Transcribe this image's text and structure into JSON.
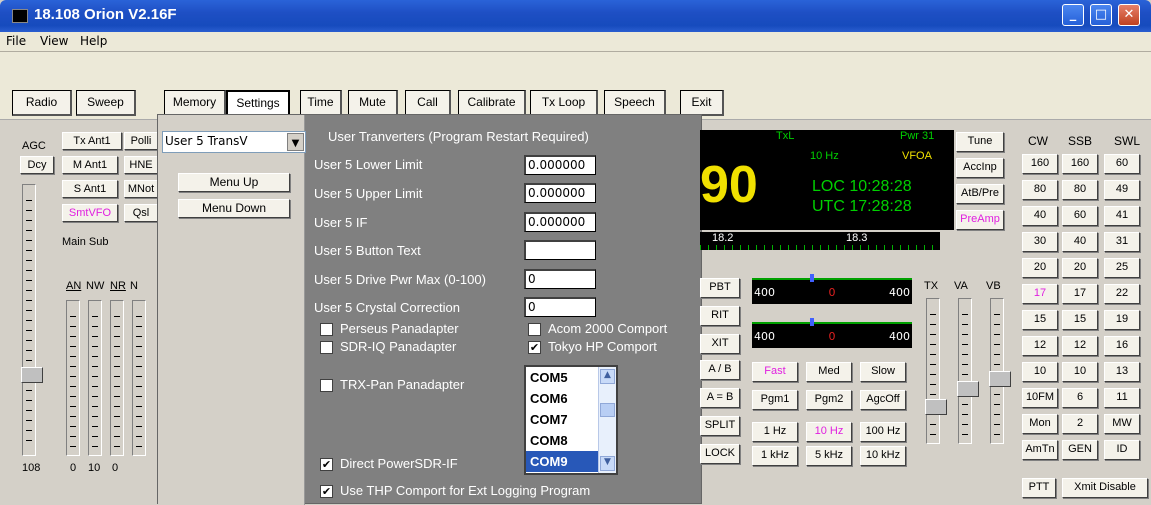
{
  "window": {
    "title": "18.108 Orion V2.16F",
    "minimize": "_",
    "maximize": "□",
    "close": "✕"
  },
  "menu": [
    "File",
    "View",
    "Help"
  ],
  "toolbar": [
    "Radio",
    "Sweep",
    "Memory",
    "Settings",
    "Time",
    "Mute",
    "Call",
    "Calibrate",
    "Tx Loop",
    "Speech",
    "Exit"
  ],
  "left": {
    "agc": "AGC",
    "dcy": "Dcy",
    "buttons": [
      "Tx Ant1",
      "Polli",
      "M Ant1",
      "HNE",
      "S Ant1",
      "MNot",
      "SmtVFO",
      "Qsl"
    ],
    "main_sub": "Main Sub",
    "an": "AN",
    "nw": "NW",
    "nr": "NR",
    "nb": "N",
    "bottom": [
      "108",
      "0",
      "10",
      "0"
    ]
  },
  "panel": {
    "dropdown": "User 5 TransV",
    "menu_up": "Menu Up",
    "menu_down": "Menu Down",
    "heading": "User Tranverters (Program Restart Required)",
    "fields": [
      {
        "label": "User 5 Lower Limit",
        "value": "0.000000"
      },
      {
        "label": "User 5 Upper Limit",
        "value": "0.000000"
      },
      {
        "label": "User 5 IF",
        "value": "0.000000"
      },
      {
        "label": "User 5 Button Text",
        "value": ""
      },
      {
        "label": "User 5 Drive Pwr Max (0-100)",
        "value": "0"
      },
      {
        "label": "User 5 Crystal Correction",
        "value": "0"
      }
    ],
    "checks": [
      {
        "label": "Perseus Panadapter",
        "checked": false
      },
      {
        "label": "SDR-IQ Panadapter",
        "checked": false
      },
      {
        "label": "Acom 2000 Comport",
        "checked": false
      },
      {
        "label": "Tokyo HP Comport",
        "checked": true
      },
      {
        "label": "TRX-Pan Panadapter",
        "checked": false
      },
      {
        "label": "Direct PowerSDR-IF",
        "checked": true
      },
      {
        "label": "Use THP Comport for Ext Logging Program",
        "checked": true
      }
    ],
    "com_list": [
      "COM5",
      "COM6",
      "COM7",
      "COM8",
      "COM9"
    ],
    "com_selected": "COM9",
    "check_mark": "✔"
  },
  "display": {
    "txl": "TxL",
    "pwr": "Pwr 31",
    "step": "10 Hz",
    "vfo": "VFOA",
    "freq_frag": "90",
    "loc": "LOC 10:28:28",
    "utc": "UTC 17:28:28",
    "scale": [
      "18.2",
      "18.3"
    ]
  },
  "controls": {
    "left_btns": [
      "PBT",
      "RIT",
      "XIT",
      "A / B",
      "A = B",
      "SPLIT",
      "LOCK"
    ],
    "meter_nums": [
      "400",
      "0",
      "400"
    ],
    "agc_row": [
      "Fast",
      "Med",
      "Slow"
    ],
    "pgm_row": [
      "Pgm1",
      "Pgm2",
      "AgcOff"
    ],
    "step_row1": [
      "1 Hz",
      "10 Hz",
      "100 Hz"
    ],
    "step_row2": [
      "1 kHz",
      "5 kHz",
      "10 kHz"
    ],
    "tx_labels": [
      "TX",
      "VA",
      "VB"
    ],
    "tune_col": [
      "Tune",
      "AccInp",
      "AtB/Pre",
      "PreAmp"
    ]
  },
  "bands": {
    "headers": [
      "CW",
      "SSB",
      "SWL"
    ],
    "rows": [
      [
        "160",
        "160",
        "60"
      ],
      [
        "80",
        "80",
        "49"
      ],
      [
        "40",
        "60",
        "41"
      ],
      [
        "30",
        "40",
        "31"
      ],
      [
        "20",
        "20",
        "25"
      ],
      [
        "17",
        "17",
        "22"
      ],
      [
        "15",
        "15",
        "19"
      ],
      [
        "12",
        "12",
        "16"
      ],
      [
        "10",
        "10",
        "13"
      ],
      [
        "10FM",
        "6",
        "11"
      ],
      [
        "Mon",
        "2",
        "MW"
      ],
      [
        "AmTn",
        "GEN",
        "ID"
      ]
    ],
    "bottom": [
      "PTT",
      "Xmit Disable"
    ]
  }
}
